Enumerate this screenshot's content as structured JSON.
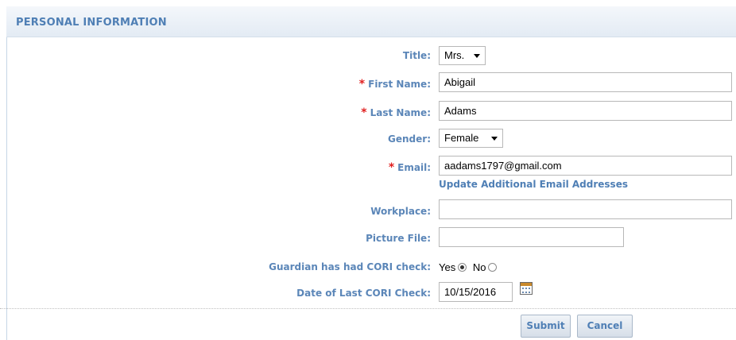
{
  "section": {
    "title": "PERSONAL INFORMATION"
  },
  "form": {
    "title": {
      "label": "Title:",
      "value": "Mrs."
    },
    "first_name": {
      "label": "First Name:",
      "value": "Abigail",
      "required_mark": "*"
    },
    "last_name": {
      "label": "Last Name:",
      "value": "Adams",
      "required_mark": "*"
    },
    "gender": {
      "label": "Gender:",
      "value": "Female"
    },
    "email": {
      "label": "Email:",
      "value": "aadams1797@gmail.com",
      "required_mark": "*",
      "update_link": "Update Additional Email Addresses"
    },
    "workplace": {
      "label": "Workplace:",
      "value": ""
    },
    "picture_file": {
      "label": "Picture File:",
      "value": ""
    },
    "cori_check": {
      "label": "Guardian has had CORI check:",
      "yes_label": "Yes",
      "no_label": "No",
      "selected": "Yes"
    },
    "cori_date": {
      "label": "Date of Last CORI Check:",
      "value": "10/15/2016"
    }
  },
  "buttons": {
    "submit": "Submit",
    "cancel": "Cancel"
  },
  "colors": {
    "label": "#5b86b8",
    "required": "#e02020",
    "header_text": "#4f7fb5"
  },
  "icons": {
    "calendar": "calendar-icon"
  }
}
